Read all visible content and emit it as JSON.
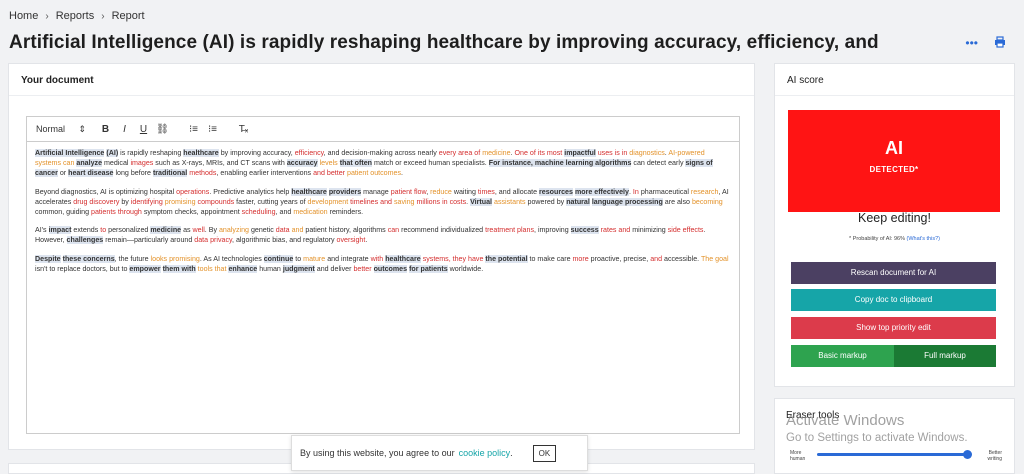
{
  "breadcrumb": {
    "home": "Home",
    "reports": "Reports",
    "current": "Report",
    "sep": "›"
  },
  "page_title": "Artificial Intelligence (AI) is rapidly reshaping healthcare by improving accuracy, efficiency, and",
  "icons": {
    "more": "more-dots-icon",
    "print": "print-icon"
  },
  "document": {
    "header": "Your document",
    "toolbar": {
      "format": "Normal",
      "bold": "B",
      "italic": "I",
      "underline": "U",
      "link": "⛓",
      "ol": "⁝≡",
      "ul": "⁝≡",
      "clear": "T̶ₓ"
    }
  },
  "ai_score": {
    "header": "AI score",
    "big": "AI",
    "small": "DETECTED*",
    "keep": "Keep editing!",
    "probability": "* Probability of AI: 96%",
    "whats_this": "(What's this?)",
    "box_color": "#ff1414"
  },
  "buttons": {
    "rescan": "Rescan document for AI",
    "copy": "Copy doc to clipboard",
    "priority": "Show top priority edit",
    "basic": "Basic markup",
    "full": "Full markup"
  },
  "eraser": {
    "title": "Eraser tools",
    "left_1": "More",
    "left_2": "human",
    "right_1": "Better",
    "right_2": "writing",
    "slider_fraction": 0.96
  },
  "watermark": {
    "line1": "Activate Windows",
    "line2": "Go to Settings to activate Windows."
  },
  "cookie": {
    "text": "By using this website, you agree to our",
    "link": "cookie policy",
    "dot": ".",
    "ok": "OK"
  },
  "colors": {
    "highlight": "#dde4ef",
    "red_text": "#d42e2e",
    "orange_text": "#e3922a",
    "purple_btn": "#4b4062",
    "teal_btn": "#16a5a8",
    "red_btn": "#dc3b4b",
    "green_btn": "#2ea34f",
    "dark_green_btn": "#1b7a34"
  },
  "editor": {
    "paragraphs": [
      [
        [
          "Artificial Intelligence",
          "hl"
        ],
        [
          " ",
          ""
        ],
        [
          "(AI)",
          "hl"
        ],
        [
          " is rapidly reshaping ",
          ""
        ],
        [
          "healthcare",
          "hl"
        ],
        [
          " by improving accuracy, ",
          ""
        ],
        [
          "efficiency",
          "rd"
        ],
        [
          ", and decision-making across nearly ",
          ""
        ],
        [
          "every area of",
          "rd"
        ],
        [
          " ",
          ""
        ],
        [
          "medicine",
          "or"
        ],
        [
          ". ",
          ""
        ],
        [
          "One of its most",
          "rd"
        ],
        [
          " ",
          ""
        ],
        [
          "impactful",
          "hl"
        ],
        [
          " ",
          ""
        ],
        [
          "uses is in",
          "rd"
        ],
        [
          " ",
          ""
        ],
        [
          "diagnostics",
          "or"
        ],
        [
          ". ",
          ""
        ],
        [
          "AI-powered systems can",
          "or"
        ],
        [
          " ",
          ""
        ],
        [
          "analyze",
          "hl"
        ],
        [
          " medical ",
          ""
        ],
        [
          "images",
          "rd"
        ],
        [
          " such as X-rays, MRIs, and CT scans with ",
          ""
        ],
        [
          "accuracy",
          "hl"
        ],
        [
          " ",
          ""
        ],
        [
          "levels",
          "or"
        ],
        [
          " ",
          ""
        ],
        [
          "that often",
          "hl"
        ],
        [
          " match or exceed human specialists. ",
          ""
        ],
        [
          "For instance, machine learning algorithms",
          "hl"
        ],
        [
          " can detect early ",
          ""
        ],
        [
          "signs of cancer",
          "hl"
        ],
        [
          " or ",
          ""
        ],
        [
          "heart disease",
          "hl"
        ],
        [
          " long before ",
          ""
        ],
        [
          "traditional",
          "hl"
        ],
        [
          " ",
          ""
        ],
        [
          "methods",
          "rd"
        ],
        [
          ", enabling earlier interventions ",
          ""
        ],
        [
          "and better",
          "rd"
        ],
        [
          " ",
          ""
        ],
        [
          "patient outcomes",
          "or"
        ],
        [
          ".",
          ""
        ]
      ],
      [
        [
          "Beyond diagnostics, AI is optimizing hospital ",
          ""
        ],
        [
          "operations",
          "rd"
        ],
        [
          ". Predictive analytics help ",
          ""
        ],
        [
          "healthcare",
          "hl"
        ],
        [
          " ",
          ""
        ],
        [
          "providers",
          "hl"
        ],
        [
          " manage ",
          ""
        ],
        [
          "patient flow",
          "rd"
        ],
        [
          ", ",
          ""
        ],
        [
          "reduce",
          "or"
        ],
        [
          " waiting ",
          ""
        ],
        [
          "times",
          "rd"
        ],
        [
          ", and allocate ",
          ""
        ],
        [
          "resources",
          "hl"
        ],
        [
          " ",
          ""
        ],
        [
          "more effectively",
          "hl"
        ],
        [
          ". ",
          ""
        ],
        [
          "In",
          "rd"
        ],
        [
          " pharmaceutical ",
          ""
        ],
        [
          "research",
          "or"
        ],
        [
          ", AI accelerates ",
          ""
        ],
        [
          "drug discovery",
          "rd"
        ],
        [
          " by ",
          ""
        ],
        [
          "identifying",
          "rd"
        ],
        [
          " ",
          ""
        ],
        [
          "promising",
          "or"
        ],
        [
          " ",
          ""
        ],
        [
          "compounds",
          "rd"
        ],
        [
          " faster, cutting years of ",
          ""
        ],
        [
          "development",
          "or"
        ],
        [
          " ",
          ""
        ],
        [
          "timelines and",
          "rd"
        ],
        [
          " ",
          ""
        ],
        [
          "saving",
          "or"
        ],
        [
          " ",
          ""
        ],
        [
          "millions in costs",
          "rd"
        ],
        [
          ". ",
          ""
        ],
        [
          "Virtual",
          "hl"
        ],
        [
          " ",
          ""
        ],
        [
          "assistants",
          "or"
        ],
        [
          " powered by ",
          ""
        ],
        [
          "natural",
          "hl"
        ],
        [
          " ",
          ""
        ],
        [
          "language processing",
          "hl"
        ],
        [
          " are also ",
          ""
        ],
        [
          "becoming",
          "or"
        ],
        [
          " common, guiding ",
          ""
        ],
        [
          "patients through",
          "rd"
        ],
        [
          " symptom checks, appointment ",
          ""
        ],
        [
          "scheduling",
          "rd"
        ],
        [
          ", and ",
          ""
        ],
        [
          "medication",
          "or"
        ],
        [
          " reminders.",
          ""
        ]
      ],
      [
        [
          "AI's ",
          ""
        ],
        [
          "impact",
          "hl"
        ],
        [
          " extends ",
          ""
        ],
        [
          "to",
          "rd"
        ],
        [
          " personalized ",
          ""
        ],
        [
          "medicine",
          "hl"
        ],
        [
          " as ",
          ""
        ],
        [
          "well",
          "rd"
        ],
        [
          ". By ",
          ""
        ],
        [
          "analyzing",
          "or"
        ],
        [
          " genetic ",
          ""
        ],
        [
          "data",
          "rd"
        ],
        [
          " ",
          ""
        ],
        [
          "and",
          "or"
        ],
        [
          " patient history, algorithms ",
          ""
        ],
        [
          "can",
          "rd"
        ],
        [
          " recommend individualized ",
          ""
        ],
        [
          "treatment plans",
          "rd"
        ],
        [
          ", improving ",
          ""
        ],
        [
          "success",
          "hl"
        ],
        [
          " ",
          ""
        ],
        [
          "rates and",
          "rd"
        ],
        [
          " minimizing ",
          ""
        ],
        [
          "side effects",
          "rd"
        ],
        [
          ". However, ",
          ""
        ],
        [
          "challenges",
          "hl"
        ],
        [
          " remain—particularly around ",
          ""
        ],
        [
          "data privacy",
          "rd"
        ],
        [
          ", algorithmic bias, and regulatory ",
          ""
        ],
        [
          "oversight",
          "rd"
        ],
        [
          ".",
          ""
        ]
      ],
      [
        [
          "Despite",
          "hl"
        ],
        [
          " ",
          ""
        ],
        [
          "these concerns",
          "hl"
        ],
        [
          ", the future ",
          ""
        ],
        [
          "looks promising",
          "or"
        ],
        [
          ". As AI technologies ",
          ""
        ],
        [
          "continue",
          "hl"
        ],
        [
          " to ",
          ""
        ],
        [
          "mature",
          "or"
        ],
        [
          " and integrate ",
          ""
        ],
        [
          "with",
          "rd"
        ],
        [
          " ",
          ""
        ],
        [
          "healthcare",
          "hl"
        ],
        [
          " ",
          ""
        ],
        [
          "systems, they have",
          "rd"
        ],
        [
          " ",
          ""
        ],
        [
          "the potential",
          "hl"
        ],
        [
          " to make care ",
          ""
        ],
        [
          "more",
          "rd"
        ],
        [
          " proactive, precise, ",
          ""
        ],
        [
          "and",
          "rd"
        ],
        [
          " accessible. ",
          ""
        ],
        [
          "The goal",
          "or"
        ],
        [
          " isn't to replace doctors, but to ",
          ""
        ],
        [
          "empower",
          "hl"
        ],
        [
          " ",
          ""
        ],
        [
          "them with",
          "hl"
        ],
        [
          " ",
          ""
        ],
        [
          "tools that",
          "or"
        ],
        [
          " ",
          ""
        ],
        [
          "enhance",
          "hl"
        ],
        [
          " human ",
          ""
        ],
        [
          "judgment",
          "hl"
        ],
        [
          " and deliver ",
          ""
        ],
        [
          "better",
          "rd"
        ],
        [
          " ",
          ""
        ],
        [
          "outcomes",
          "hl"
        ],
        [
          " ",
          ""
        ],
        [
          "for patients",
          "hl"
        ],
        [
          " worldwide.",
          ""
        ]
      ]
    ]
  }
}
